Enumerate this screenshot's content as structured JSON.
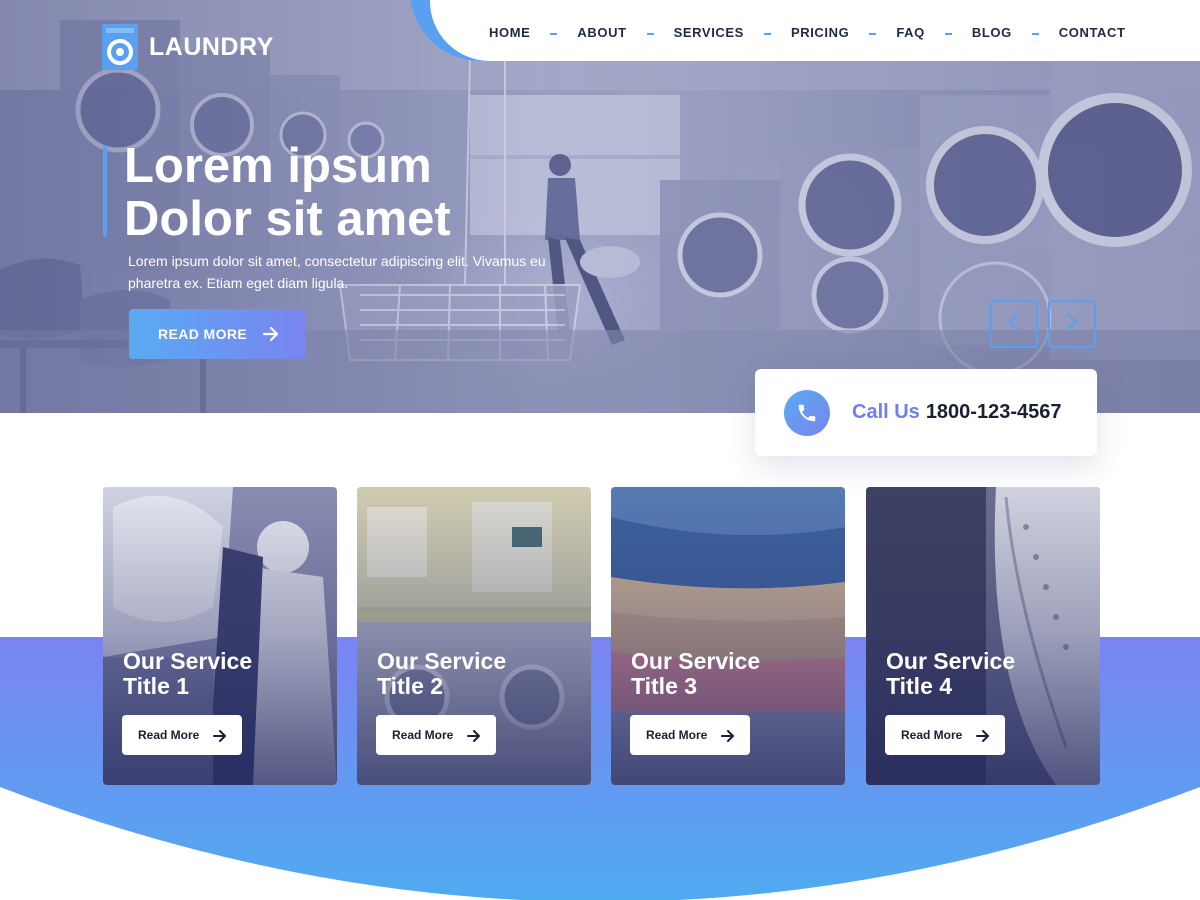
{
  "brand": {
    "name": "LAUNDRY",
    "logo_icon": "washing-machine-icon"
  },
  "nav": {
    "items": [
      {
        "label": "HOME"
      },
      {
        "label": "ABOUT"
      },
      {
        "label": "SERVICES"
      },
      {
        "label": "PRICING"
      },
      {
        "label": "FAQ"
      },
      {
        "label": "BLOG"
      },
      {
        "label": "CONTACT"
      }
    ]
  },
  "hero": {
    "title_line1": "Lorem ipsum",
    "title_line2": "Dolor sit amet",
    "subtitle": "Lorem ipsum dolor sit amet, consectetur adipiscing elit. Vivamus eu pharetra ex. Etiam eget diam ligula.",
    "button_label": "READ MORE",
    "button_icon": "arrow-right-icon",
    "slider_prev_icon": "chevron-left-icon",
    "slider_next_icon": "chevron-right-icon"
  },
  "call": {
    "icon": "phone-icon",
    "label": "Call Us",
    "number": "1800-123-4567"
  },
  "services": [
    {
      "title_line1": "Our Service",
      "title_line2": "Title 1",
      "button_label": "Read More"
    },
    {
      "title_line1": "Our Service",
      "title_line2": "Title 2",
      "button_label": "Read More"
    },
    {
      "title_line1": "Our Service",
      "title_line2": "Title 3",
      "button_label": "Read More"
    },
    {
      "title_line1": "Our Service",
      "title_line2": "Title 4",
      "button_label": "Read More"
    }
  ],
  "colors": {
    "accent_blue": "#5aa0f0",
    "accent_violet": "#7a84f0",
    "band_top": "#7b84f2",
    "band_bottom": "#4fabf0",
    "nav_text": "#1f2a44",
    "call_label": "#6f7ff0"
  }
}
